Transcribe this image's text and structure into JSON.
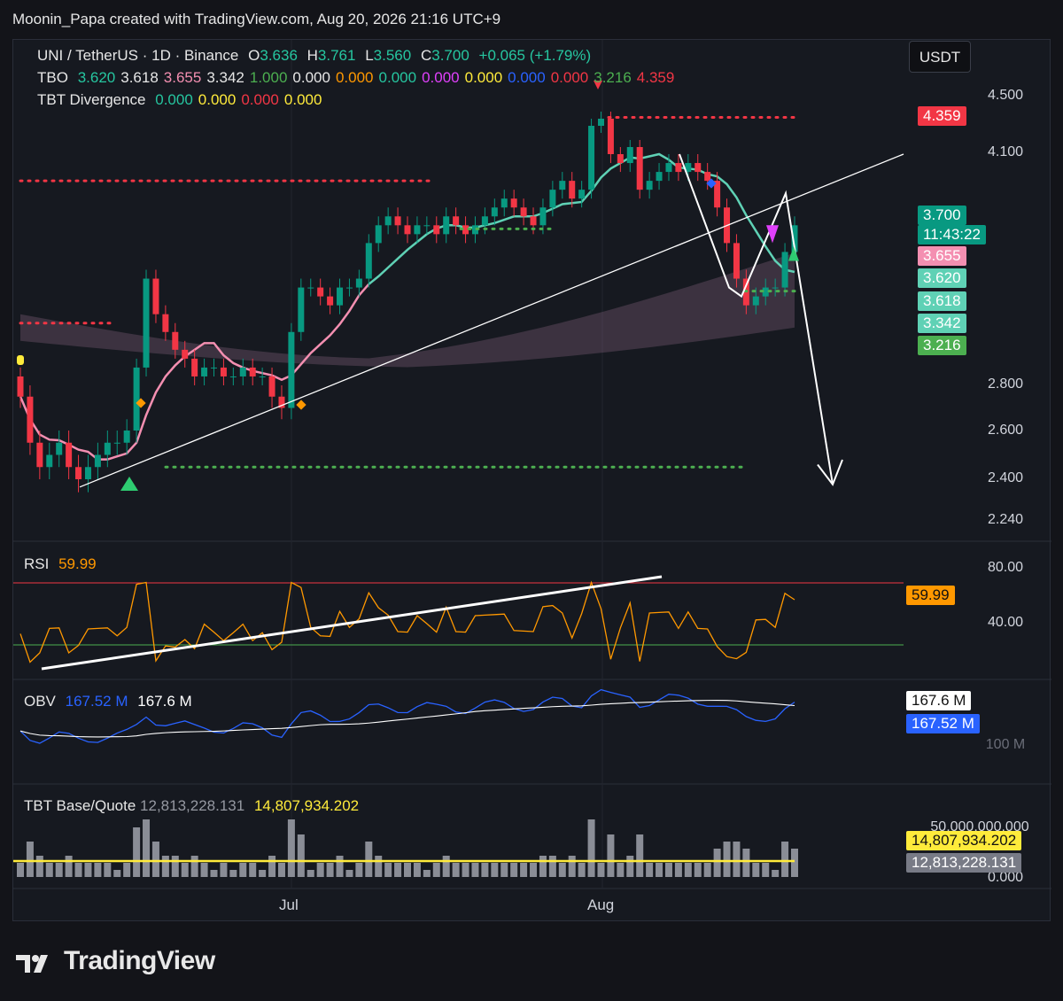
{
  "header": "Moonin_Papa created with TradingView.com, Aug 20, 2026 21:16 UTC+9",
  "brand": "TradingView",
  "currency_button": "USDT",
  "legend": {
    "symbol": "UNI / TetherUS · 1D · Binance",
    "o_label": "O",
    "o": "3.636",
    "h_label": "H",
    "h": "3.761",
    "l_label": "L",
    "l": "3.560",
    "c_label": "C",
    "c": "3.700",
    "change": "+0.065 (+1.79%)",
    "tbo_label": "TBO",
    "tbo_values": [
      {
        "v": "3.620",
        "color": "#26c6a0"
      },
      {
        "v": "3.618",
        "color": "#e6e6e6"
      },
      {
        "v": "3.655",
        "color": "#f48fb1"
      },
      {
        "v": "3.342",
        "color": "#e6e6e6"
      },
      {
        "v": "1.000",
        "color": "#4caf50"
      },
      {
        "v": "0.000",
        "color": "#e6e6e6"
      },
      {
        "v": "0.000",
        "color": "#ff9800"
      },
      {
        "v": "0.000",
        "color": "#26c6a0"
      },
      {
        "v": "0.000",
        "color": "#e040fb"
      },
      {
        "v": "0.000",
        "color": "#ffeb3b"
      },
      {
        "v": "0.000",
        "color": "#2962ff"
      },
      {
        "v": "0.000",
        "color": "#f23645"
      },
      {
        "v": "3.216",
        "color": "#4caf50"
      },
      {
        "v": "4.359",
        "color": "#f23645"
      }
    ],
    "div_label": "TBT Divergence",
    "div_values": [
      {
        "v": "0.000",
        "color": "#26c6a0"
      },
      {
        "v": "0.000",
        "color": "#ffeb3b"
      },
      {
        "v": "0.000",
        "color": "#f23645"
      },
      {
        "v": "0.000",
        "color": "#ffeb3b"
      }
    ]
  },
  "price_axis": [
    "4.500",
    "4.100",
    "2.800",
    "2.600",
    "2.400",
    "2.240"
  ],
  "price_tags": [
    {
      "v": "4.359",
      "bg": "#f23645"
    },
    {
      "v": "3.700",
      "bg": "#089981"
    },
    {
      "v": "11:43:22",
      "bg": "#089981"
    },
    {
      "v": "3.655",
      "bg": "#f48fb1"
    },
    {
      "v": "3.620",
      "bg": "#5fd1b5"
    },
    {
      "v": "3.618",
      "bg": "#5fd1b5"
    },
    {
      "v": "3.342",
      "bg": "#5fd1b5"
    },
    {
      "v": "3.216",
      "bg": "#4caf50"
    }
  ],
  "x_labels": [
    "Jul",
    "Aug"
  ],
  "rsi": {
    "label": "RSI",
    "value": "59.99",
    "axis": [
      "80.00",
      "40.00"
    ],
    "tag": "59.99"
  },
  "obv": {
    "label": "OBV",
    "v1": "167.52 M",
    "v2": "167.6 M",
    "tag1": "167.6 M",
    "tag2": "167.52 M",
    "axis": "100 M"
  },
  "vol": {
    "label": "TBT Base/Quote",
    "v1": "12,813,228.131",
    "v2": "14,807,934.202",
    "axis_top": "50,000,000,000",
    "axis_bottom": "0.000",
    "tag1": "14,807,934.202",
    "tag2": "12,813,228.131"
  },
  "chart_data": {
    "type": "candlestick",
    "title": "UNI / TetherUS · 1D · Binance",
    "ylim": [
      2.2,
      4.6
    ],
    "ohlc_last": {
      "open": 3.636,
      "high": 3.761,
      "low": 3.56,
      "close": 3.7
    },
    "closes": [
      2.75,
      2.55,
      2.45,
      2.5,
      2.55,
      2.45,
      2.4,
      2.45,
      2.5,
      2.55,
      2.55,
      2.6,
      2.9,
      3.4,
      3.2,
      3.1,
      3.0,
      2.95,
      2.85,
      2.9,
      2.9,
      2.85,
      2.85,
      2.9,
      2.85,
      2.85,
      2.75,
      2.7,
      3.1,
      3.35,
      3.35,
      3.3,
      3.25,
      3.35,
      3.35,
      3.4,
      3.6,
      3.7,
      3.75,
      3.7,
      3.65,
      3.7,
      3.7,
      3.65,
      3.75,
      3.7,
      3.65,
      3.7,
      3.75,
      3.8,
      3.85,
      3.8,
      3.75,
      3.7,
      3.8,
      3.9,
      3.95,
      3.85,
      3.9,
      4.3,
      4.35,
      4.1,
      4.05,
      4.15,
      3.9,
      3.95,
      4.0,
      4.05,
      4.0,
      4.05,
      4.0,
      3.95,
      3.8,
      3.6,
      3.4,
      3.25,
      3.3,
      3.35,
      3.35,
      3.55,
      3.7
    ],
    "key_levels": {
      "resistance": 4.359,
      "support": 2.45,
      "upper_band": 3.655,
      "tbo_fast": 3.62,
      "tbo_slow": 3.618,
      "tbo_base": 3.342,
      "tbo_low": 3.216
    }
  }
}
